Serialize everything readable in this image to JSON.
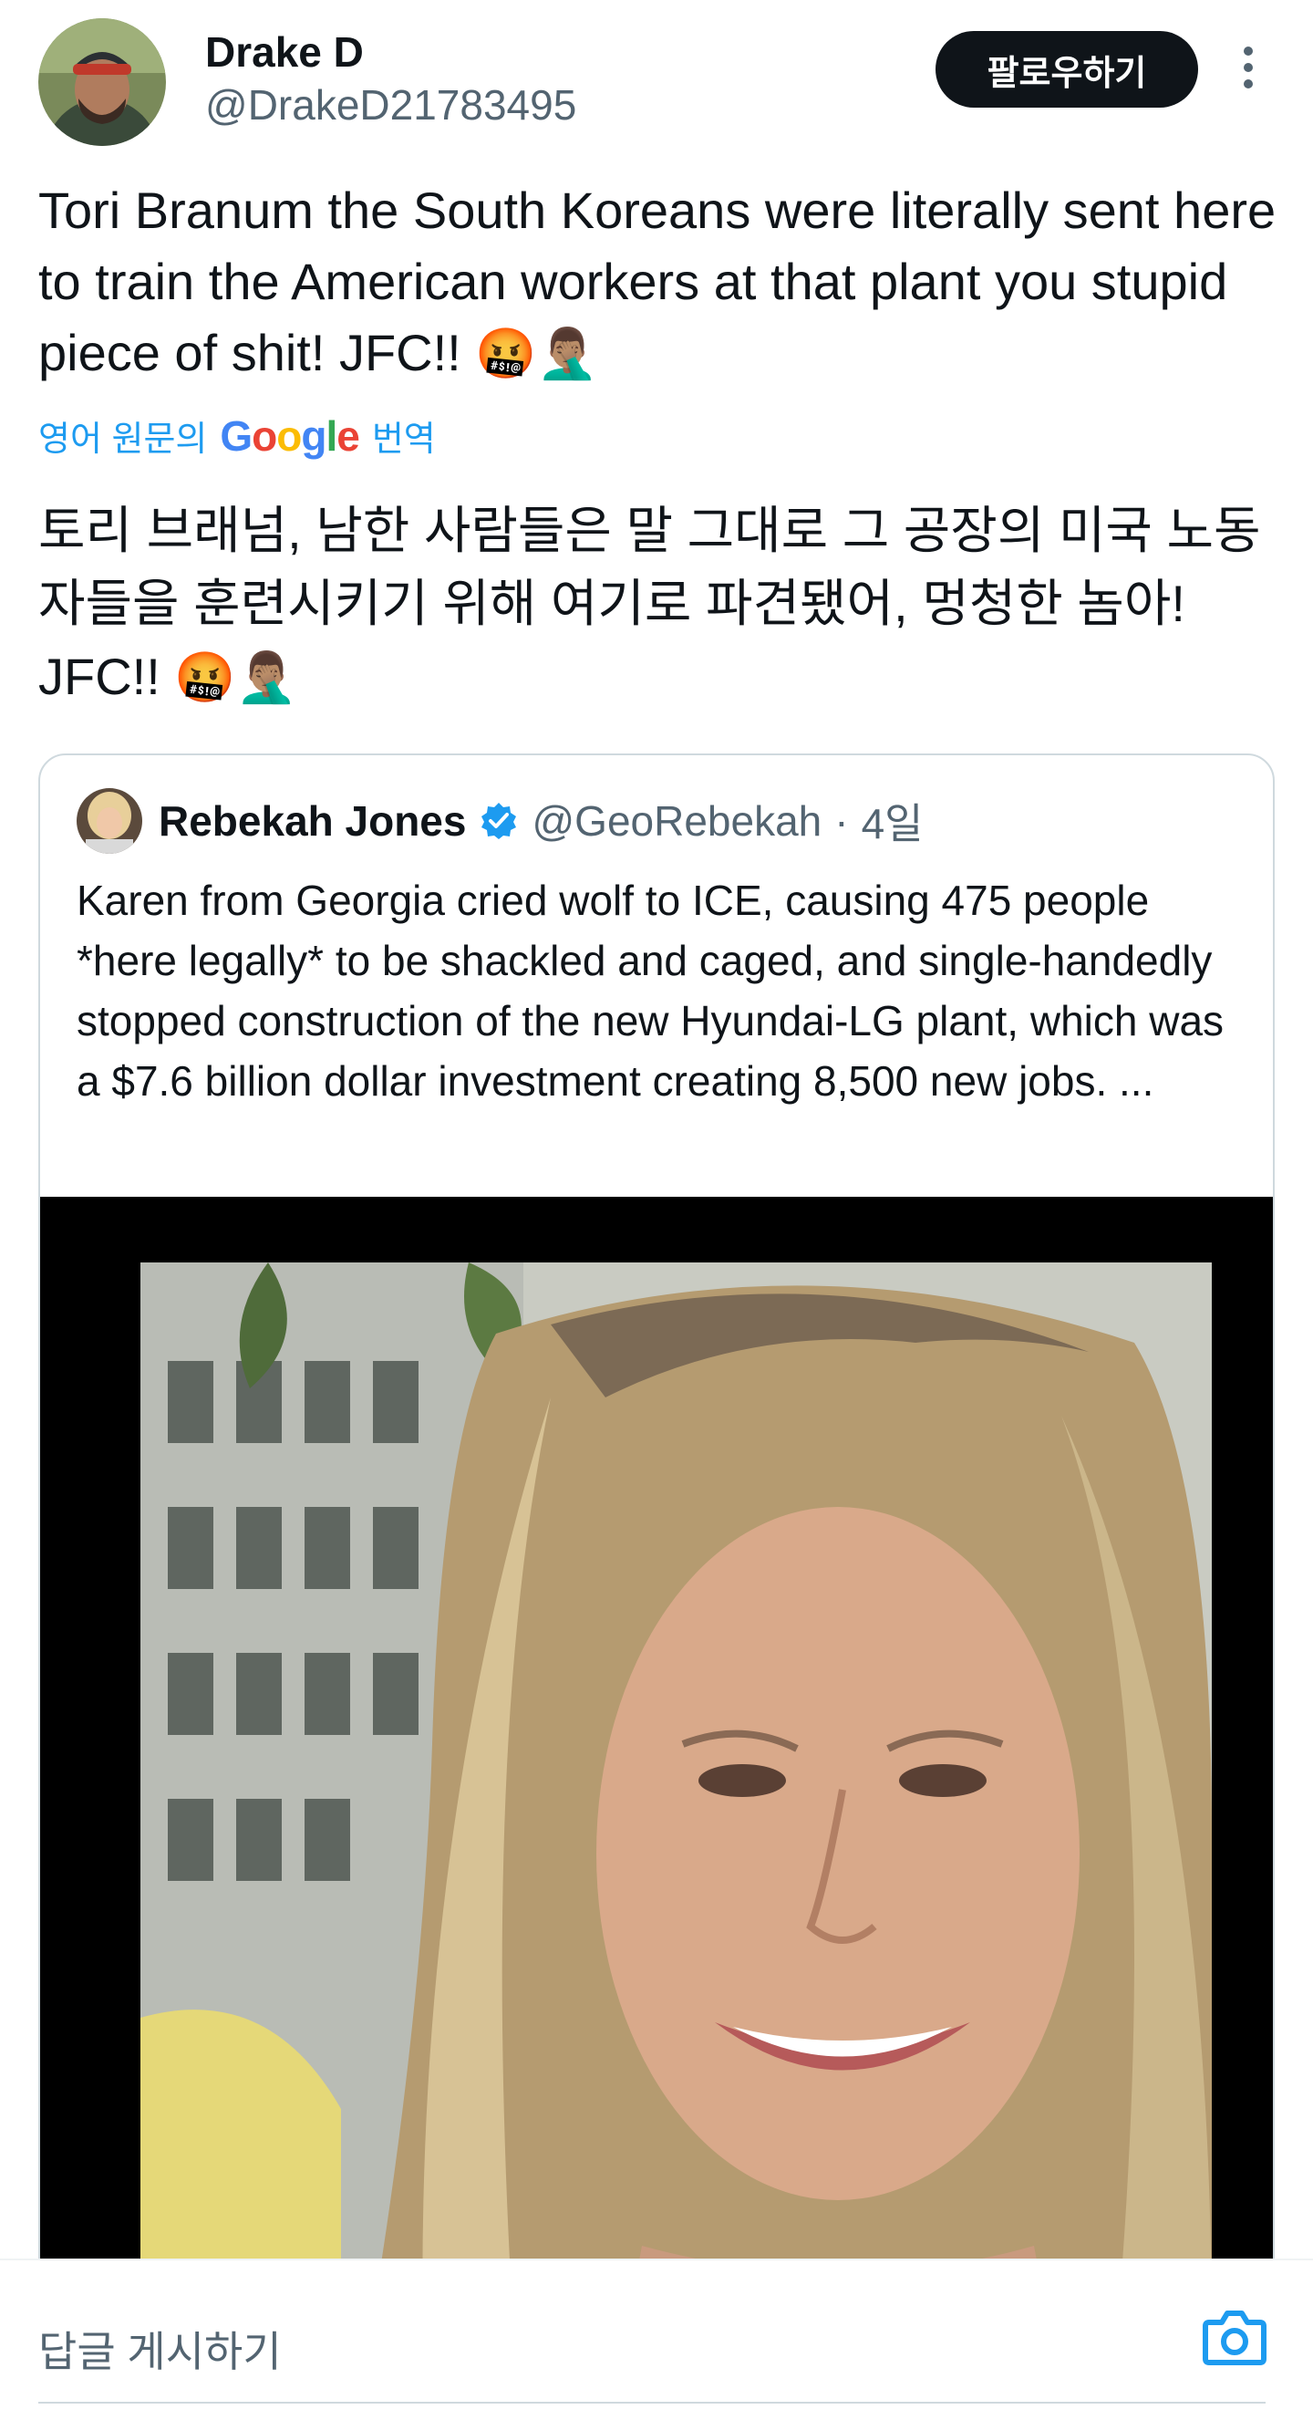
{
  "author": {
    "display_name": "Drake D",
    "handle": "@DrakeD21783495",
    "follow_label": "팔로우하기",
    "avatar": "profile-photo"
  },
  "tweet": {
    "text": "Tori Branum the South Koreans were literally sent here to train the American workers at that plant you stupid piece of shit! JFC!!",
    "emojis": "🤬🤦🏽‍♂️",
    "translate_prefix": "영어 원문의",
    "translate_provider": "Google",
    "translate_suffix": "번역",
    "translated_text": "토리 브래넘, 남한 사람들은 말 그대로 그 공장의 미국 노동자들을 훈련시키기 위해 여기로 파견됐어, 멍청한 놈아! JFC!!",
    "translated_emojis": "🤬🤦🏽‍♂️"
  },
  "quoted_tweet": {
    "display_name": "Rebekah Jones",
    "handle": "@GeoRebekah",
    "separator": "·",
    "time": "4일",
    "verified": true,
    "text": "Karen from Georgia cried wolf to ICE, causing 475 people *here legally* to be shackled and caged, and single-handedly stopped construction of the new Hyundai-LG plant, which was a $7.6 billion dollar investment creating 8,500 new jobs. ...",
    "media": "photo-of-smiling-blonde-woman"
  },
  "reply_bar": {
    "placeholder": "답글 게시하기",
    "camera_icon": "camera-icon"
  },
  "colors": {
    "text_primary": "#0f1419",
    "text_secondary": "#536471",
    "accent_blue": "#1d9bf0",
    "follow_button_bg": "#0f1419",
    "border": "#cfd9de"
  }
}
